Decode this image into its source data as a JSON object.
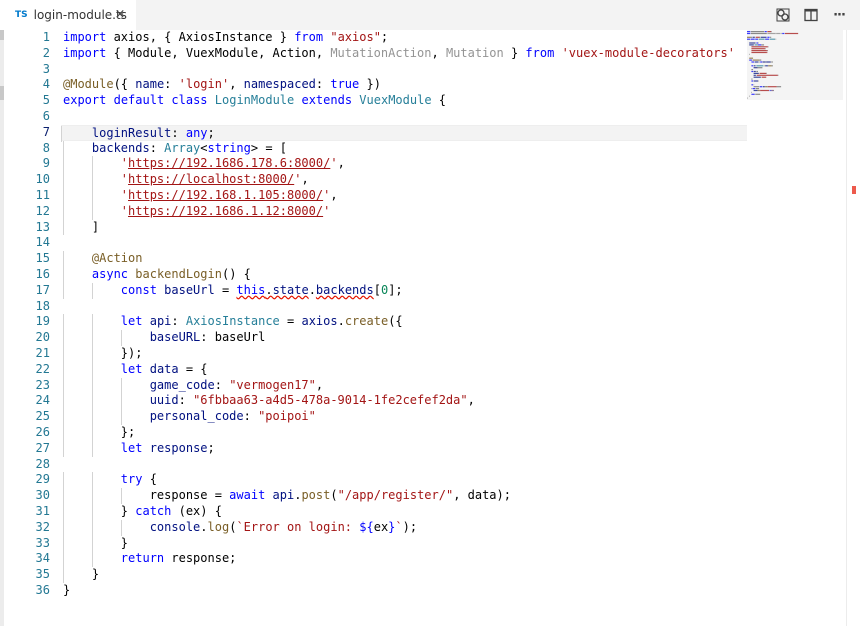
{
  "tab": {
    "lang_badge": "TS",
    "title": "login-module.ts",
    "close_glyph": "×"
  },
  "actions": [
    {
      "name": "open-changes-icon"
    },
    {
      "name": "split-editor-icon"
    },
    {
      "name": "more-actions-icon",
      "glyph": "···"
    }
  ],
  "editor": {
    "active_line": 7,
    "lines": [
      [
        [
          "import",
          "kw"
        ],
        [
          " axios, { AxiosInstance } ",
          ""
        ],
        [
          "from",
          "kw"
        ],
        [
          " ",
          ""
        ],
        [
          "\"axios\"",
          "str"
        ],
        [
          ";",
          ""
        ]
      ],
      [
        [
          "import",
          "kw"
        ],
        [
          " { Module, VuexModule, Action, ",
          ""
        ],
        [
          "MutationAction",
          "unused"
        ],
        [
          ", ",
          ""
        ],
        [
          "Mutation",
          "unused"
        ],
        [
          " } ",
          ""
        ],
        [
          "from",
          "kw"
        ],
        [
          " ",
          ""
        ],
        [
          "'vuex-module-decorators'",
          "str"
        ]
      ],
      [],
      [
        [
          "@Module",
          "dec"
        ],
        [
          "({ ",
          ""
        ],
        [
          "name",
          "prop"
        ],
        [
          ": ",
          ""
        ],
        [
          "'login'",
          "str"
        ],
        [
          ", ",
          ""
        ],
        [
          "namespaced",
          "prop"
        ],
        [
          ": ",
          ""
        ],
        [
          "true",
          "kw"
        ],
        [
          " })",
          ""
        ]
      ],
      [
        [
          "export",
          "kw"
        ],
        [
          " ",
          ""
        ],
        [
          "default",
          "kw"
        ],
        [
          " ",
          ""
        ],
        [
          "class",
          "kw"
        ],
        [
          " ",
          ""
        ],
        [
          "LoginModule",
          "ty"
        ],
        [
          " ",
          ""
        ],
        [
          "extends",
          "kw"
        ],
        [
          " ",
          ""
        ],
        [
          "VuexModule",
          "ty"
        ],
        [
          " {",
          ""
        ]
      ],
      [],
      [
        [
          "    ",
          ""
        ],
        [
          "loginResult",
          "var"
        ],
        [
          ": ",
          ""
        ],
        [
          "any",
          "kw"
        ],
        [
          ";",
          ""
        ]
      ],
      [
        [
          "    ",
          ""
        ],
        [
          "backends",
          "var"
        ],
        [
          ": ",
          ""
        ],
        [
          "Array",
          "ty"
        ],
        [
          "<",
          ""
        ],
        [
          "string",
          "kw"
        ],
        [
          "> = [",
          ""
        ]
      ],
      [
        [
          "        ",
          ""
        ],
        [
          "'",
          "str"
        ],
        [
          "https://192.1686.178.6:8000/",
          "str link"
        ],
        [
          "'",
          "str"
        ],
        [
          ",",
          ""
        ]
      ],
      [
        [
          "        ",
          ""
        ],
        [
          "'",
          "str"
        ],
        [
          "https://localhost:8000/",
          "str link"
        ],
        [
          "'",
          "str"
        ],
        [
          ",",
          ""
        ]
      ],
      [
        [
          "        ",
          ""
        ],
        [
          "'",
          "str"
        ],
        [
          "https://192.168.1.105:8000/",
          "str link"
        ],
        [
          "'",
          "str"
        ],
        [
          ",",
          ""
        ]
      ],
      [
        [
          "        ",
          ""
        ],
        [
          "'",
          "str"
        ],
        [
          "https://192.1686.1.12:8000/",
          "str link"
        ],
        [
          "'",
          "str"
        ]
      ],
      [
        [
          "    ]",
          ""
        ]
      ],
      [],
      [
        [
          "    ",
          ""
        ],
        [
          "@Action",
          "dec"
        ]
      ],
      [
        [
          "    ",
          ""
        ],
        [
          "async",
          "kw"
        ],
        [
          " ",
          ""
        ],
        [
          "backendLogin",
          "fn"
        ],
        [
          "() {",
          ""
        ]
      ],
      [
        [
          "        ",
          ""
        ],
        [
          "const",
          "kw"
        ],
        [
          " ",
          ""
        ],
        [
          "baseUrl",
          "var"
        ],
        [
          " = ",
          ""
        ],
        [
          "this",
          "kw err"
        ],
        [
          ".",
          "err"
        ],
        [
          "state",
          "var err"
        ],
        [
          ".",
          ""
        ],
        [
          "backends",
          "var err"
        ],
        [
          "[",
          ""
        ],
        [
          "0",
          "num"
        ],
        [
          "];",
          ""
        ]
      ],
      [],
      [
        [
          "        ",
          ""
        ],
        [
          "let",
          "kw"
        ],
        [
          " ",
          ""
        ],
        [
          "api",
          "var"
        ],
        [
          ": ",
          ""
        ],
        [
          "AxiosInstance",
          "ty"
        ],
        [
          " = ",
          ""
        ],
        [
          "axios",
          "var"
        ],
        [
          ".",
          ""
        ],
        [
          "create",
          "fn"
        ],
        [
          "({",
          ""
        ]
      ],
      [
        [
          "            ",
          ""
        ],
        [
          "baseURL",
          "prop"
        ],
        [
          ": baseUrl",
          ""
        ]
      ],
      [
        [
          "        });",
          ""
        ]
      ],
      [
        [
          "        ",
          ""
        ],
        [
          "let",
          "kw"
        ],
        [
          " ",
          ""
        ],
        [
          "data",
          "var"
        ],
        [
          " = {",
          ""
        ]
      ],
      [
        [
          "            ",
          ""
        ],
        [
          "game_code",
          "prop"
        ],
        [
          ": ",
          ""
        ],
        [
          "\"vermogen17\"",
          "str"
        ],
        [
          ",",
          ""
        ]
      ],
      [
        [
          "            ",
          ""
        ],
        [
          "uuid",
          "prop"
        ],
        [
          ": ",
          ""
        ],
        [
          "\"6fbbaa63-a4d5-478a-9014-1fe2cefef2da\"",
          "str"
        ],
        [
          ",",
          ""
        ]
      ],
      [
        [
          "            ",
          ""
        ],
        [
          "personal_code",
          "prop"
        ],
        [
          ": ",
          ""
        ],
        [
          "\"poipoi\"",
          "str"
        ]
      ],
      [
        [
          "        };",
          ""
        ]
      ],
      [
        [
          "        ",
          ""
        ],
        [
          "let",
          "kw"
        ],
        [
          " ",
          ""
        ],
        [
          "response",
          "var"
        ],
        [
          ";",
          ""
        ]
      ],
      [],
      [
        [
          "        ",
          ""
        ],
        [
          "try",
          "kw"
        ],
        [
          " {",
          ""
        ]
      ],
      [
        [
          "            response = ",
          ""
        ],
        [
          "await",
          "kw"
        ],
        [
          " ",
          ""
        ],
        [
          "api",
          "var"
        ],
        [
          ".",
          ""
        ],
        [
          "post",
          "fn"
        ],
        [
          "(",
          ""
        ],
        [
          "\"/app/register/\"",
          "str"
        ],
        [
          ", data);",
          ""
        ]
      ],
      [
        [
          "        } ",
          ""
        ],
        [
          "catch",
          "kw"
        ],
        [
          " (ex) {",
          ""
        ]
      ],
      [
        [
          "            ",
          ""
        ],
        [
          "console",
          "var"
        ],
        [
          ".",
          ""
        ],
        [
          "log",
          "fn"
        ],
        [
          "(",
          ""
        ],
        [
          "`Error on login: ",
          "str"
        ],
        [
          "${",
          "kw"
        ],
        [
          "ex",
          ""
        ],
        [
          "}",
          "kw"
        ],
        [
          "`",
          "str"
        ],
        [
          ");",
          ""
        ]
      ],
      [
        [
          "        }",
          ""
        ]
      ],
      [
        [
          "        ",
          ""
        ],
        [
          "return",
          "kw"
        ],
        [
          " response;",
          ""
        ]
      ],
      [
        [
          "    }",
          ""
        ]
      ],
      [
        [
          "}",
          ""
        ]
      ]
    ]
  },
  "colors": {
    "keyword": "#0000ff",
    "string": "#a31515",
    "type": "#267f99",
    "function": "#795e26",
    "variable": "#001080",
    "line_number": "#237893",
    "error_squiggle": "#e51400"
  }
}
